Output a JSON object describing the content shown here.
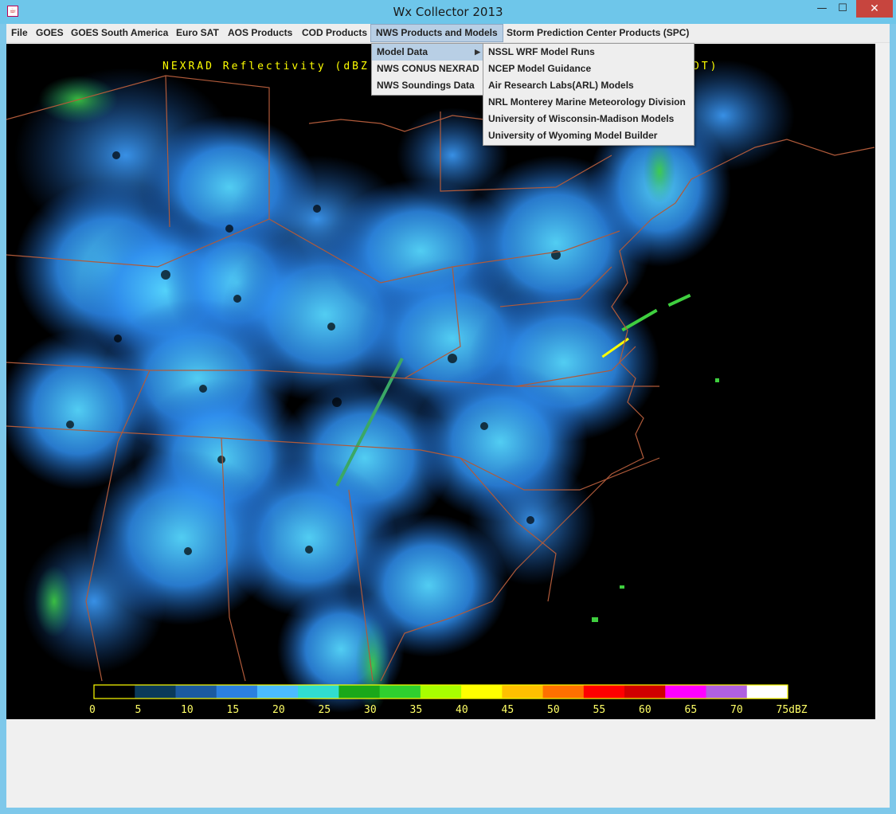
{
  "window": {
    "title": "Wx Collector 2013",
    "icon": "java-cup-icon",
    "controls": {
      "minimize": "—",
      "maximize": "☐",
      "close": "✕"
    }
  },
  "menubar": {
    "items": [
      "File",
      "GOES",
      "GOES South America",
      "Euro SAT",
      "AOS Products",
      "COD Products",
      "NWS Products and Models",
      "Storm Prediction Center Products (SPC)"
    ],
    "active": "NWS Products and Models"
  },
  "nws_menu": {
    "items": [
      "Model Data",
      "NWS CONUS NEXRAD",
      "NWS Soundings Data"
    ],
    "highlighted": "Model Data"
  },
  "model_submenu": {
    "items": [
      "NSSL WRF Model Runs",
      "NCEP Model Guidance",
      "Air Research Labs(ARL) Models",
      "NRL Monterey Marine Meteorology Division",
      "University of Wisconsin-Madison Models",
      "University of Wyoming Model Builder"
    ]
  },
  "radar": {
    "header_left": "NEXRAD Reflectivity (dBZ)",
    "header_right": "DT)",
    "colors": {
      "background": "#000000",
      "echo_light": "#1e6fd0",
      "echo_mid": "#3ea0ff",
      "echo_bright": "#56d8ff",
      "echo_green": "#3fcf3f",
      "border_lines": "#b05a3a",
      "legend_text": "#ffff66"
    },
    "legend": {
      "labels": [
        "0",
        "5",
        "10",
        "15",
        "20",
        "25",
        "30",
        "35",
        "40",
        "45",
        "50",
        "55",
        "60",
        "65",
        "70",
        "75dBZ"
      ],
      "colors": [
        "#000000",
        "#0a3a5a",
        "#1b5aa0",
        "#2b80e0",
        "#4bbcff",
        "#30ddd0",
        "#1aa81a",
        "#2fd02f",
        "#a8ff00",
        "#ffff00",
        "#ffc000",
        "#ff7000",
        "#ff0000",
        "#d00000",
        "#ff00ff",
        "#b060e0",
        "#ffffff"
      ]
    }
  }
}
